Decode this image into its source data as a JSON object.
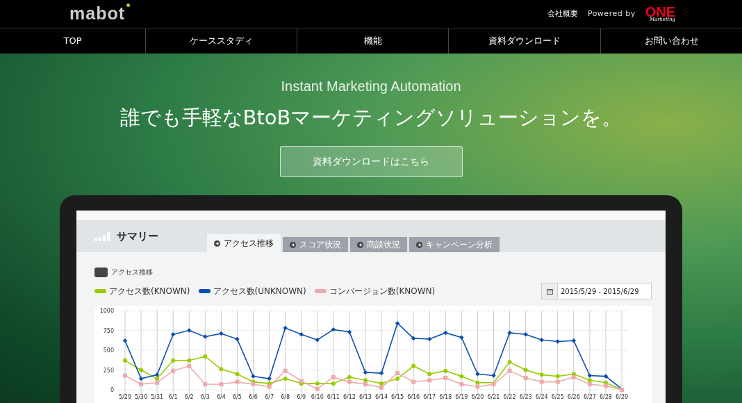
{
  "header": {
    "logo": "mabot",
    "links": [
      "会社概要"
    ],
    "powered_by": "Powered by",
    "brand": "ONE",
    "brand_sub": "Marketing"
  },
  "nav": [
    {
      "label": "TOP"
    },
    {
      "label": "ケーススタディ"
    },
    {
      "label": "機能"
    },
    {
      "label": "資料ダウンロード"
    },
    {
      "label": "お問い合わせ"
    }
  ],
  "hero": {
    "subtitle": "Instant Marketing Automation",
    "title": "誰でも手軽なBtoBマーケティングソリューションを。",
    "cta": "資料ダウンロードはこちら"
  },
  "dashboard": {
    "title": "サマリー",
    "tabs": [
      {
        "label": "アクセス推移",
        "selected": true
      },
      {
        "label": "スコア状況",
        "selected": false
      },
      {
        "label": "商談状況",
        "selected": false
      },
      {
        "label": "キャンペーン分析",
        "selected": false
      }
    ],
    "section_title": "アクセス推移",
    "date_range": "2015/5/29 - 2015/6/29",
    "chart_data": {
      "type": "line",
      "categories": [
        "5/29",
        "5/30",
        "5/31",
        "6/1",
        "6/2",
        "6/3",
        "6/4",
        "6/5",
        "6/6",
        "6/7",
        "6/8",
        "6/9",
        "6/10",
        "6/11",
        "6/12",
        "6/13",
        "6/14",
        "6/15",
        "6/16",
        "6/17",
        "6/18",
        "6/19",
        "6/20",
        "6/21",
        "6/22",
        "6/23",
        "6/24",
        "6/25",
        "6/26",
        "6/27",
        "6/28",
        "6/29"
      ],
      "ylim": [
        0,
        1000
      ],
      "grid": true,
      "yticks": [
        0,
        250,
        500,
        750,
        1000
      ],
      "series": [
        {
          "name": "アクセス数(KNOWN)",
          "color": "#99cc00",
          "marker": "circle",
          "values": [
            370,
            250,
            140,
            370,
            370,
            420,
            260,
            200,
            100,
            80,
            140,
            80,
            80,
            80,
            160,
            120,
            80,
            140,
            300,
            200,
            240,
            170,
            90,
            90,
            350,
            250,
            190,
            170,
            200,
            120,
            90,
            0
          ]
        },
        {
          "name": "アクセス数(UNKNOWN)",
          "color": "#0c4fb0",
          "marker": "diamond",
          "values": [
            620,
            140,
            190,
            700,
            750,
            670,
            710,
            640,
            170,
            140,
            780,
            700,
            630,
            760,
            730,
            220,
            210,
            840,
            650,
            640,
            720,
            660,
            200,
            180,
            720,
            700,
            630,
            610,
            620,
            180,
            170,
            10
          ]
        },
        {
          "name": "コンバージョン数(KNOWN)",
          "color": "#eeaaaa",
          "marker": "square",
          "values": [
            180,
            70,
            90,
            240,
            300,
            70,
            70,
            100,
            70,
            40,
            240,
            110,
            10,
            160,
            100,
            70,
            30,
            210,
            100,
            120,
            150,
            70,
            40,
            70,
            240,
            150,
            100,
            100,
            160,
            70,
            50,
            0
          ]
        }
      ]
    }
  }
}
